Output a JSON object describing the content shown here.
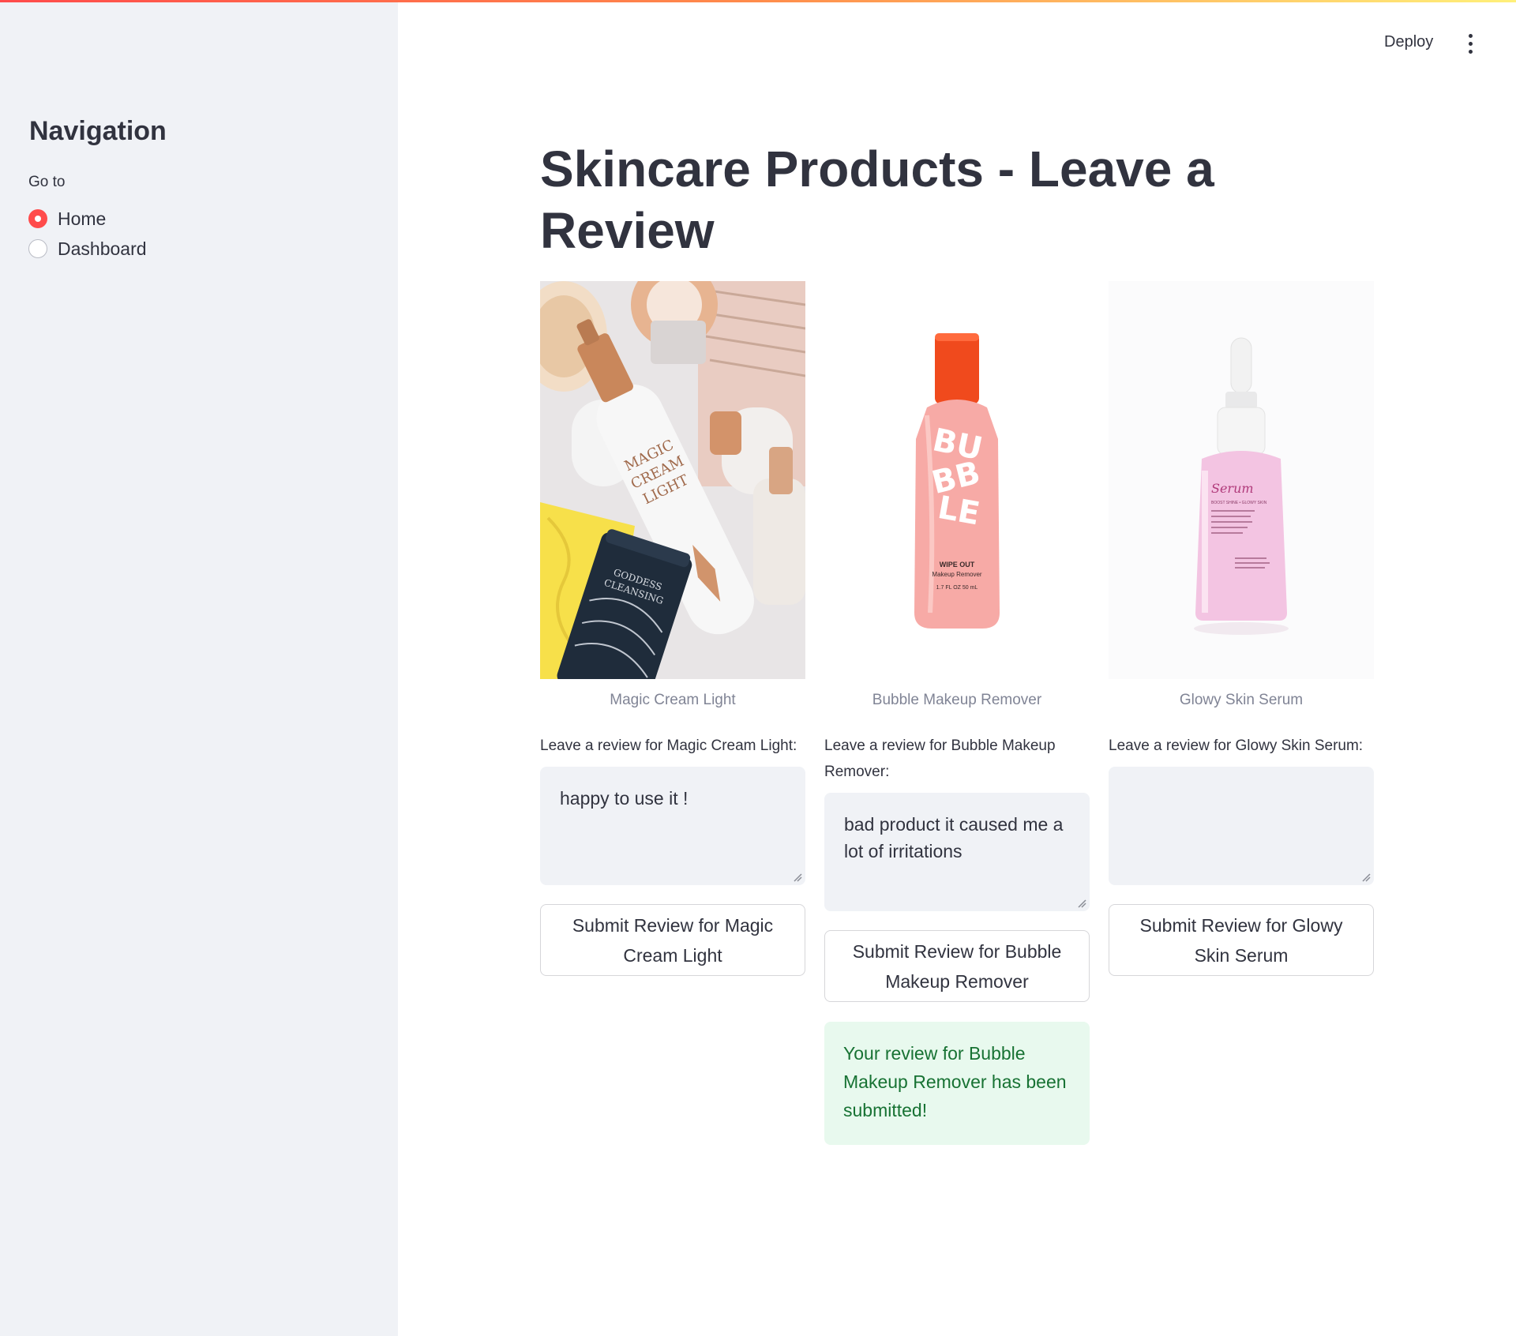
{
  "sidebar": {
    "title": "Navigation",
    "goto_label": "Go to",
    "options": [
      {
        "label": "Home",
        "selected": true
      },
      {
        "label": "Dashboard",
        "selected": false
      }
    ]
  },
  "header": {
    "deploy_label": "Deploy",
    "menu_icon": "kebab-menu-icon"
  },
  "main": {
    "title": "Skincare Products - Leave a Review",
    "products": [
      {
        "name": "Magic Cream Light",
        "review_label": "Leave a review for Magic Cream Light:",
        "review_value": "happy to use it !",
        "submit_label": "Submit Review for Magic Cream Light"
      },
      {
        "name": "Bubble Makeup Remover",
        "review_label": "Leave a review for Bubble Makeup Remover:",
        "review_value": "bad product it caused me a lot of irritations",
        "submit_label": "Submit Review for Bubble Makeup Remover",
        "bottle_brand": "BUBBLE",
        "bottle_line1": "WIPE OUT",
        "bottle_line2": "Makeup Remover",
        "bottle_line3": "1.7 FL OZ 50 mL",
        "success_message": "Your review for Bubble Makeup Remover has been submitted!"
      },
      {
        "name": "Glowy Skin Serum",
        "review_label": "Leave a review for Glowy Skin Serum:",
        "review_value": "",
        "submit_label": "Submit Review for Glowy Skin Serum",
        "bottle_brand": "Serum",
        "bottle_line1": "BOOST SHINE • GLOWY SKIN"
      }
    ]
  },
  "colors": {
    "accent": "#ff4b4b",
    "sidebar_bg": "#f0f2f6",
    "success_bg": "#e8f9ee",
    "success_text": "#177233"
  }
}
